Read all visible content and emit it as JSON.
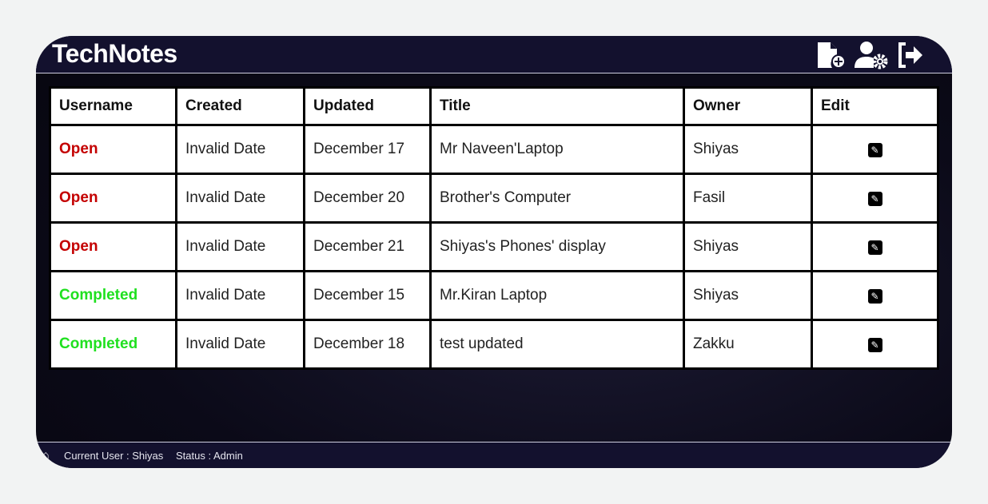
{
  "header": {
    "title": "TechNotes",
    "icons": [
      "new-note-icon",
      "user-settings-icon",
      "logout-icon"
    ]
  },
  "table": {
    "headers": [
      "Username",
      "Created",
      "Updated",
      "Title",
      "Owner",
      "Edit"
    ],
    "rows": [
      {
        "status": "Open",
        "created": "Invalid Date",
        "updated": "December 17",
        "title": "Mr Naveen'Laptop",
        "owner": "Shiyas"
      },
      {
        "status": "Open",
        "created": "Invalid Date",
        "updated": "December 20",
        "title": "Brother's Computer",
        "owner": "Fasil"
      },
      {
        "status": "Open",
        "created": "Invalid Date",
        "updated": "December 21",
        "title": "Shiyas's Phones' display",
        "owner": "Shiyas"
      },
      {
        "status": "Completed",
        "created": "Invalid Date",
        "updated": "December 15",
        "title": "Mr.Kiran Laptop",
        "owner": "Shiyas"
      },
      {
        "status": "Completed",
        "created": "Invalid Date",
        "updated": "December 18",
        "title": "test updated",
        "owner": "Zakku"
      }
    ]
  },
  "footer": {
    "user": "Current User : Shiyas",
    "status": "Status : Admin"
  },
  "colors": {
    "open": "#c40000",
    "completed": "#1fe01f",
    "header_bg": "#13112e"
  }
}
